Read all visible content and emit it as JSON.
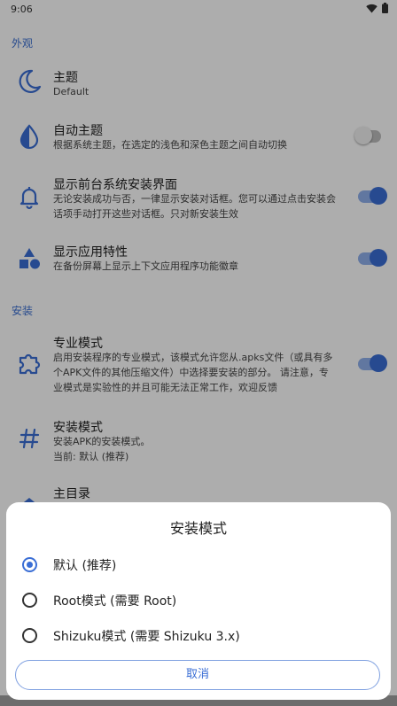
{
  "status": {
    "time": "9:06"
  },
  "sections": {
    "appearance": "外观",
    "install": "安装"
  },
  "items": [
    {
      "title": "主题",
      "subtitle": "Default"
    },
    {
      "title": "自动主题",
      "subtitle": "根据系统主题，在选定的浅色和深色主题之间自动切换"
    },
    {
      "title": "显示前台系统安装界面",
      "subtitle": "无论安装成功与否，一律显示安装对话框。您可以通过点击安装会话项手动打开这些对话框。只对新安装生效"
    },
    {
      "title": "显示应用特性",
      "subtitle": "在备份屏幕上显示上下文应用程序功能徽章"
    },
    {
      "title": "专业模式",
      "subtitle": "启用安装程序的专业模式，该模式允许您从.apks文件（或具有多个APK文件的其他压缩文件）中选择要安装的部分。 请注意，专业模式是实验性的并且可能无法正常工作，欢迎反馈"
    },
    {
      "title": "安装模式",
      "subtitle": "安装APK的安装模式。",
      "current": "当前: 默认 (推荐)"
    },
    {
      "title": "主目录"
    }
  ],
  "toggles": {
    "auto_theme": false,
    "show_install_ui": true,
    "show_features": true,
    "pro_mode": true
  },
  "dialog": {
    "title": "安装模式",
    "options": [
      "默认 (推荐)",
      "Root模式 (需要 Root)",
      "Shizuku模式 (需要 Shizuku 3.x)"
    ],
    "selected": 0,
    "cancel": "取消"
  },
  "colors": {
    "accent": "#3a6ed5"
  }
}
